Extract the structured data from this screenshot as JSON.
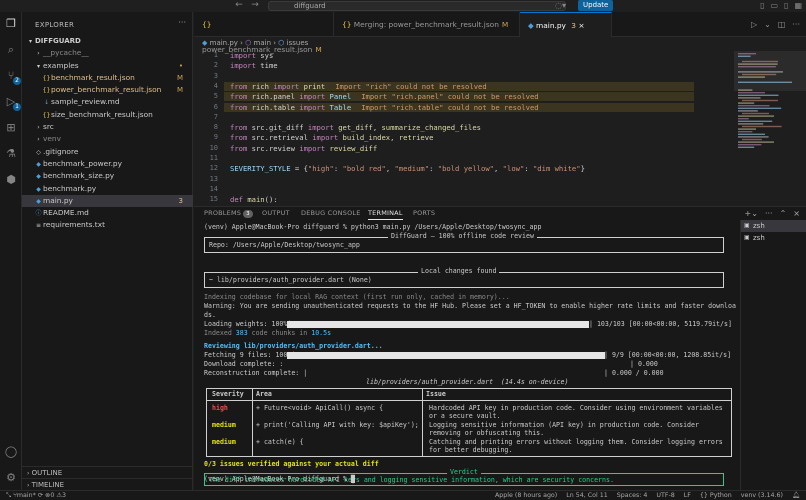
{
  "titlebar": {
    "search_text": "diffguard",
    "update_label": "Update"
  },
  "explorer": {
    "header": "EXPLORER",
    "root": "DIFFGUARD",
    "items": [
      {
        "label": "__pycache__",
        "indent": 1,
        "kind": "folder"
      },
      {
        "label": "examples",
        "indent": 1,
        "kind": "folder-open",
        "status": "dot"
      },
      {
        "label": "benchmark_result.json",
        "indent": 2,
        "kind": "json",
        "status": "M"
      },
      {
        "label": "power_benchmark_result.json",
        "indent": 2,
        "kind": "json",
        "status": "M"
      },
      {
        "label": "sample_review.md",
        "indent": 2,
        "kind": "md"
      },
      {
        "label": "size_benchmark_result.json",
        "indent": 2,
        "kind": "json"
      },
      {
        "label": "src",
        "indent": 1,
        "kind": "folder"
      },
      {
        "label": "venv",
        "indent": 1,
        "kind": "folder"
      },
      {
        "label": ".gitignore",
        "indent": 1,
        "kind": "git"
      },
      {
        "label": "benchmark_power.py",
        "indent": 1,
        "kind": "py"
      },
      {
        "label": "benchmark_size.py",
        "indent": 1,
        "kind": "py"
      },
      {
        "label": "benchmark.py",
        "indent": 1,
        "kind": "py"
      },
      {
        "label": "main.py",
        "indent": 1,
        "kind": "py",
        "status": "3"
      },
      {
        "label": "README.md",
        "indent": 1,
        "kind": "info"
      },
      {
        "label": "requirements.txt",
        "indent": 1,
        "kind": "txt"
      }
    ],
    "outline": "OUTLINE",
    "timeline": "TIMELINE"
  },
  "tabs": [
    {
      "label": "power_benchmark_result.json",
      "mark": "M"
    },
    {
      "label": "Merging: power_benchmark_result.json",
      "mark": "M"
    },
    {
      "label": "main.py",
      "mark": "3"
    }
  ],
  "breadcrumb": {
    "file": "main.py",
    "sym1": "main",
    "sym2": "issues"
  },
  "code": [
    {
      "n": "1",
      "t": "import sys"
    },
    {
      "n": "2",
      "t": "import time"
    },
    {
      "n": "3",
      "t": ""
    },
    {
      "n": "4",
      "t": "from rich import print",
      "w": "Import \"rich\" could not be resolved"
    },
    {
      "n": "5",
      "t": "from rich.panel import Panel",
      "w": "Import \"rich.panel\" could not be resolved"
    },
    {
      "n": "6",
      "t": "from rich.table import Table",
      "w": "Import \"rich.table\" could not be resolved"
    },
    {
      "n": "7",
      "t": ""
    },
    {
      "n": "8",
      "t": "from src.git_diff import get_diff, summarize_changed_files"
    },
    {
      "n": "9",
      "t": "from src.retrieval import build_index, retrieve"
    },
    {
      "n": "10",
      "t": "from src.review import review_diff"
    },
    {
      "n": "11",
      "t": ""
    },
    {
      "n": "12",
      "t": "SEVERITY_STYLE = {\"high\": \"bold red\", \"medium\": \"bold yellow\", \"low\": \"dim white\"}"
    },
    {
      "n": "13",
      "t": ""
    },
    {
      "n": "14",
      "t": ""
    },
    {
      "n": "15",
      "t": "def main():"
    }
  ],
  "panel": {
    "tabs": {
      "problems": "PROBLEMS",
      "problems_count": "3",
      "output": "OUTPUT",
      "debug": "DEBUG CONSOLE",
      "terminal": "TERMINAL",
      "ports": "PORTS"
    },
    "sessions": [
      "zsh",
      "zsh"
    ]
  },
  "terminal": {
    "cmd": "(venv) Apple@MacBook-Pro diffguard % python3 main.py /Users/Apple/Desktop/twosync_app",
    "banner_title": "DiffGuard — 100% offline code review",
    "repo": "Repo: /Users/Apple/Desktop/twosync_app",
    "changes_title": "Local changes found",
    "changes": "~ lib/providers/auth_provider.dart (None)",
    "indexing": "Indexing codebase for local RAG context (first run only, cached in memory)...",
    "warning1": "Warning: You are sending unauthenticated requests to the HF Hub. Please set a HF_TOKEN to enable higher rate limits and faster downloa",
    "warning2": "ds.",
    "loading_label": "Loading weights: 100%|",
    "loading_stats": "| 103/103 [00:00<00:00, 5119.79it/s]",
    "loading_progress": 1.0,
    "indexed_pre": "Indexed ",
    "indexed_num": "383",
    "indexed_mid": " code chunks in ",
    "indexed_time": "10.5s",
    "reviewing": "Reviewing lib/providers/auth_provider.dart...",
    "fetch_label": "Fetching 9 files: 100%|",
    "fetch_stats": "| 9/9 [00:00<00:00, 1208.85it/s]",
    "fetch_progress": 1.0,
    "download_label": "Download complete: :",
    "download_stats": "| 0.000",
    "recon_label": "Reconstruction complete: |",
    "recon_stats": "| 0.000 / 0.000",
    "table_caption": "lib/providers/auth_provider.dart  (14.4s on-device)",
    "table_headers": [
      "Severity",
      "Area",
      "Issue"
    ],
    "rows": [
      {
        "severity": "high",
        "area": "+ Future<void> ApiCall() async {",
        "issue1": "Hardcoded API key in production code. Consider using environment variables",
        "issue2": "or a secure vault."
      },
      {
        "severity": "medium",
        "area": "+ print('Calling API with key: $apiKey');",
        "issue1": "Logging sensitive information (API key) in production code. Consider",
        "issue2": "removing or obfuscating this."
      },
      {
        "severity": "medium",
        "area": "+ catch(e) {",
        "issue1": "Catching and printing errors without logging them. Consider logging errors",
        "issue2": "for better debugging."
      }
    ],
    "verified": "0/3 issues verified against your actual diff",
    "verdict_title": "Verdict",
    "verdict": "The diff introduces hardcoded API keys and logging sensitive information, which are security concerns.",
    "prompt": "(venv) Apple@MacBook-Pro diffguard % "
  },
  "statusbar": {
    "branch": "main*",
    "errors": "0",
    "warnings": "3",
    "blame": "Apple (8 hours ago)",
    "position": "Ln 54, Col 11",
    "spaces": "Spaces: 4",
    "encoding": "UTF-8",
    "eol": "LF",
    "language": "Python",
    "venv": "venv (3.14.6)"
  },
  "colors": {
    "accent": "#0078d4",
    "severity_high": "#f14c4c",
    "severity_medium": "#e5e510",
    "verdict": "#23d18b"
  }
}
